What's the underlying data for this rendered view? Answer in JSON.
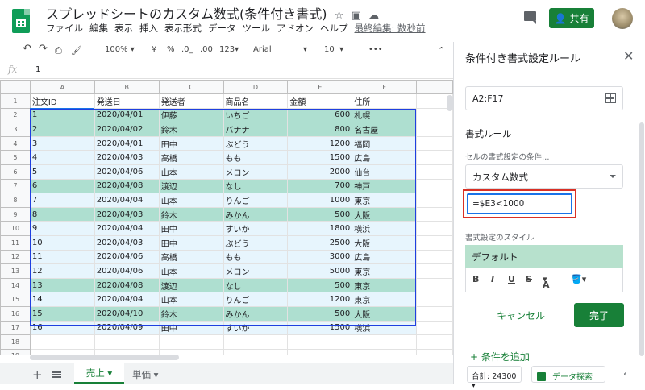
{
  "header": {
    "title": "スプレッドシートのカスタム数式(条件付き書式)",
    "menus": [
      "ファイル",
      "編集",
      "表示",
      "挿入",
      "表示形式",
      "データ",
      "ツール",
      "アドオン",
      "ヘルプ"
    ],
    "last_edit": "最終編集: 数秒前",
    "share_label": "共有"
  },
  "toolbar": {
    "zoom": "100%",
    "currency": "¥",
    "percent": "%",
    "dec_less": ".0_",
    "dec_more": ".00",
    "format123": "123",
    "font": "Arial",
    "size": "10",
    "more": "•••"
  },
  "formula_bar": {
    "fx": "fx",
    "value": "1"
  },
  "grid": {
    "columns": [
      "A",
      "B",
      "C",
      "D",
      "E",
      "F"
    ],
    "header_row": [
      "注文ID",
      "発送日",
      "発送者",
      "商品名",
      "金額",
      "住所"
    ],
    "rows": [
      [
        "1",
        "2020/04/01",
        "伊藤",
        "いちご",
        "600",
        "札幌"
      ],
      [
        "2",
        "2020/04/02",
        "鈴木",
        "バナナ",
        "800",
        "名古屋"
      ],
      [
        "3",
        "2020/04/01",
        "田中",
        "ぶどう",
        "1200",
        "福岡"
      ],
      [
        "4",
        "2020/04/03",
        "高橋",
        "もも",
        "1500",
        "広島"
      ],
      [
        "5",
        "2020/04/06",
        "山本",
        "メロン",
        "2000",
        "仙台"
      ],
      [
        "6",
        "2020/04/08",
        "渡辺",
        "なし",
        "700",
        "神戸"
      ],
      [
        "7",
        "2020/04/04",
        "山本",
        "りんご",
        "1000",
        "東京"
      ],
      [
        "8",
        "2020/04/03",
        "鈴木",
        "みかん",
        "500",
        "大阪"
      ],
      [
        "9",
        "2020/04/04",
        "田中",
        "すいか",
        "1800",
        "横浜"
      ],
      [
        "10",
        "2020/04/03",
        "田中",
        "ぶどう",
        "2500",
        "大阪"
      ],
      [
        "11",
        "2020/04/06",
        "高橋",
        "もも",
        "3000",
        "広島"
      ],
      [
        "12",
        "2020/04/06",
        "山本",
        "メロン",
        "5000",
        "東京"
      ],
      [
        "13",
        "2020/04/08",
        "渡辺",
        "なし",
        "500",
        "東京"
      ],
      [
        "14",
        "2020/04/04",
        "山本",
        "りんご",
        "1200",
        "東京"
      ],
      [
        "15",
        "2020/04/10",
        "鈴木",
        "みかん",
        "500",
        "大阪"
      ],
      [
        "16",
        "2020/04/09",
        "田中",
        "すいか",
        "1500",
        "横浜"
      ]
    ],
    "row_numbers": [
      "1",
      "2",
      "3",
      "4",
      "5",
      "6",
      "7",
      "8",
      "9",
      "10",
      "11",
      "12",
      "13",
      "14",
      "15",
      "16",
      "17",
      "18",
      "19"
    ],
    "highlight_color": "#aedfd0",
    "plain_color": "#e7f5fd"
  },
  "sheets": {
    "active": "売上",
    "other": "単価"
  },
  "panel": {
    "title": "条件付き書式設定ルール",
    "range": "A2:F17",
    "rules_heading": "書式ルール",
    "condition_label": "セルの書式設定の条件…",
    "condition_value": "カスタム数式",
    "formula": "=$E3<1000",
    "style_label": "書式設定のスタイル",
    "style_preview": "デフォルト",
    "style_buttons": [
      "B",
      "I",
      "U",
      "S",
      "A"
    ],
    "cancel": "キャンセル",
    "done": "完了",
    "add_rule": "+ 条件を追加",
    "accent": "#188038"
  },
  "status": {
    "sum": "合計: 24300",
    "explore": "データ探索"
  }
}
